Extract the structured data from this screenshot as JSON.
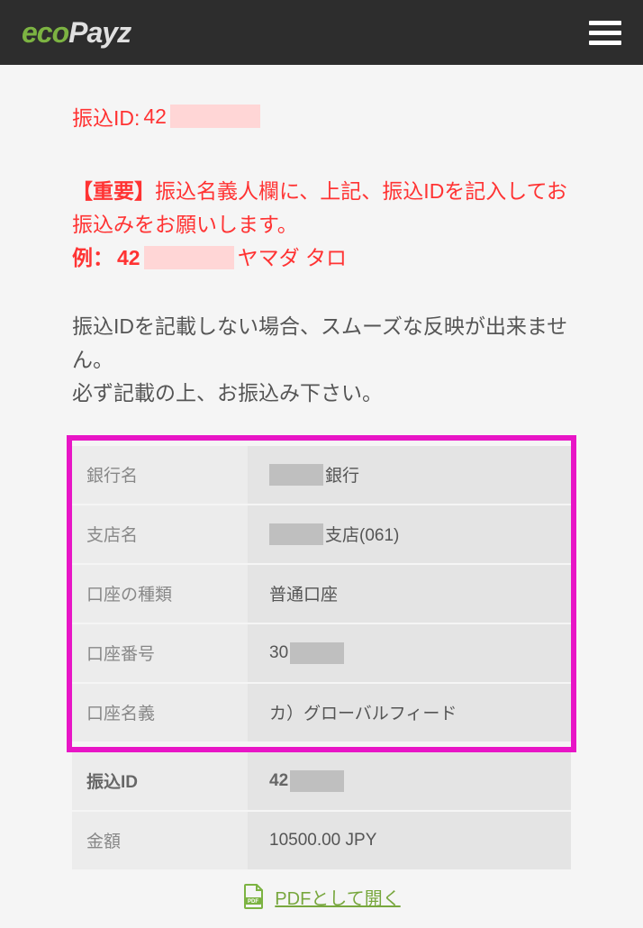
{
  "logo": {
    "eco": "eco",
    "payz": "Payz"
  },
  "transfer": {
    "label_prefix": "振込ID: ",
    "id_prefix": "42"
  },
  "important": {
    "marker": "【重要】",
    "line1": "振込名義人欄に、上記、振込IDを記入してお振込みをお願いします。",
    "example_prefix": "例：",
    "example_id": "42",
    "example_name": "ヤマダ タロ"
  },
  "note": {
    "line1": "振込IDを記載しない場合、スムーズな反映が出来ません。",
    "line2": "必ず記載の上、お振込み下さい。"
  },
  "table": {
    "bank_label": "銀行名",
    "bank_value_suffix": "銀行",
    "branch_label": "支店名",
    "branch_value_suffix": "支店(061)",
    "account_type_label": "口座の種類",
    "account_type_value": "普通口座",
    "account_number_label": "口座番号",
    "account_number_prefix": "30",
    "account_name_label": "口座名義",
    "account_name_value": "カ）グローバルフィード",
    "transfer_id_label": "振込ID",
    "transfer_id_prefix": "42",
    "amount_label": "金額",
    "amount_value": "10500.00 JPY"
  },
  "pdf_link": "PDFとして開く"
}
